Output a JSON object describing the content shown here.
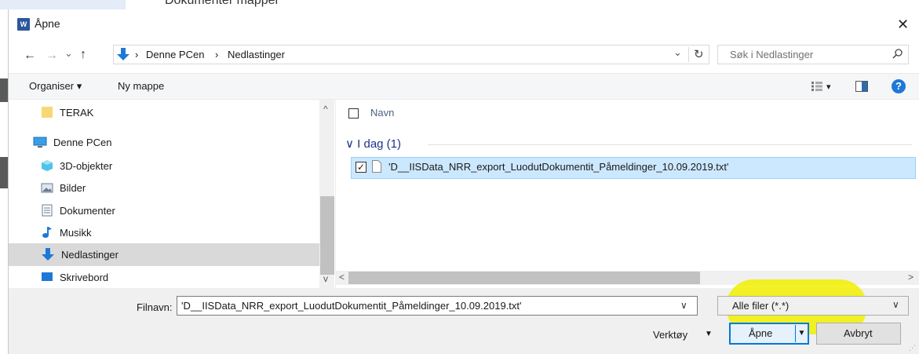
{
  "background": {
    "partial_text": "Dokumenter    mapper"
  },
  "dialog": {
    "app_icon_letter": "W",
    "title": "Åpne",
    "close_glyph": "✕"
  },
  "address_bar": {
    "back": "←",
    "forward": "→",
    "recent": "⌄",
    "up": "↑",
    "location_icon": "downloads-arrow-icon",
    "breadcrumb": [
      "Denne PCen",
      "Nedlastinger"
    ],
    "separator": "›",
    "dropdown": "⌄",
    "refresh": "↻"
  },
  "search": {
    "placeholder": "Søk i Nedlastinger",
    "icon": "⚲"
  },
  "toolbar": {
    "organise": "Organiser ▾",
    "new_folder": "Ny mappe",
    "view_dropdown": "▾",
    "help": "?"
  },
  "nav": {
    "items": [
      {
        "label": "TERAK",
        "icon": "folder-icon"
      },
      {
        "label": "Denne PCen",
        "icon": "computer-icon"
      },
      {
        "label": "3D-objekter",
        "icon": "cube-icon"
      },
      {
        "label": "Bilder",
        "icon": "pictures-icon"
      },
      {
        "label": "Dokumenter",
        "icon": "document-icon"
      },
      {
        "label": "Musikk",
        "icon": "music-icon"
      },
      {
        "label": "Nedlastinger",
        "icon": "downloads-icon",
        "selected": true
      },
      {
        "label": "Skrivebord",
        "icon": "desktop-icon"
      }
    ],
    "scroll_up": "^",
    "scroll_down": "v"
  },
  "file_list": {
    "column_name": "Navn",
    "group": "I dag (1)",
    "group_chevron": "∨",
    "files": [
      {
        "name": "'D__IISData_NRR_export_LuodutDokumentit_Påmeldinger_10.09.2019.txt'",
        "checked": true
      }
    ],
    "scroll_left": "<",
    "scroll_right": ">"
  },
  "bottom": {
    "filename_label": "Filnavn:",
    "filename_value": "'D__IISData_NRR_export_LuodutDokumentit_Påmeldinger_10.09.2019.txt'",
    "filename_dropdown": "∨",
    "filter_value": "Alle filer (*.*)",
    "filter_dropdown": "∨",
    "tools_label": "Verktøy",
    "tools_dropdown": "▼",
    "open_label": "Åpne",
    "open_split": "▼",
    "cancel_label": "Avbryt"
  },
  "colors": {
    "selection": "#cce8ff",
    "selection_border": "#99d1ff",
    "accent": "#0078d7",
    "highlight": "#f0f000",
    "group_header": "#1e3287"
  }
}
